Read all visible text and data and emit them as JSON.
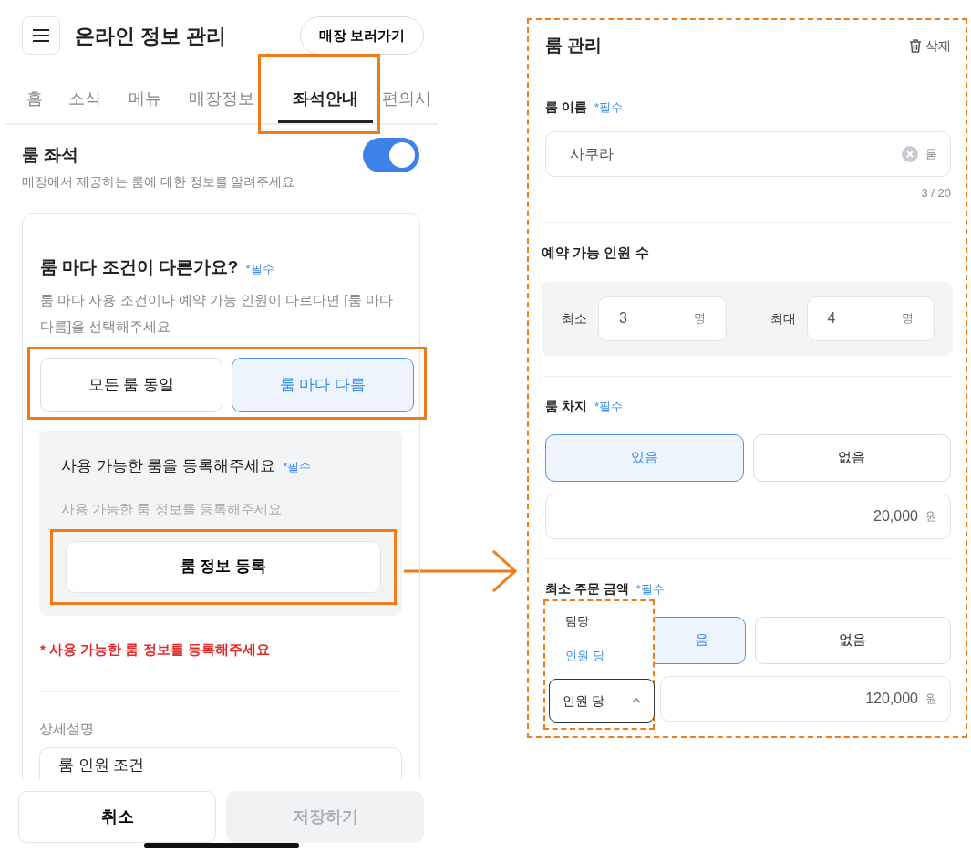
{
  "header": {
    "title": "온라인 정보 관리",
    "store_button": "매장 보러가기"
  },
  "tabs": [
    {
      "label": "홈",
      "selected": false
    },
    {
      "label": "소식",
      "selected": false
    },
    {
      "label": "메뉴",
      "selected": false
    },
    {
      "label": "매장정보",
      "selected": false
    },
    {
      "label": "좌석안내",
      "selected": true
    },
    {
      "label": "편의시",
      "selected": false
    }
  ],
  "room_seating": {
    "title": "룸 좌석",
    "on": true,
    "description": "매장에서 제공하는 룸에 대한 정보를 알려주세요"
  },
  "condition": {
    "question": "룸 마다 조건이 다른가요?",
    "required": "*필수",
    "description": "룸 마다 사용 조건이나 예약 가능 인원이 다르다면 [룸 마다 다름]을 선택해주세요",
    "options": [
      {
        "label": "모든 룸 동일",
        "selected": false
      },
      {
        "label": "룸 마다 다름",
        "selected": true
      }
    ]
  },
  "rooms": {
    "title": "사용 가능한 룸을 등록해주세요",
    "required": "*필수",
    "hint": "사용 가능한 룸 정보를 등록해주세요",
    "register_button": "룸 정보 등록"
  },
  "error": "* 사용 가능한 룸 정보를 등록해주세요",
  "detail": {
    "label": "상세설명",
    "value": "룸 인원 조건"
  },
  "footer": {
    "cancel": "취소",
    "save": {
      "label": "저장하기",
      "disabled": true
    }
  },
  "room_panel": {
    "title": "룸 관리",
    "delete": "삭제",
    "name": {
      "label": "룸 이름",
      "required": "*필수",
      "value": "사쿠라",
      "suffix": "룸",
      "counter": "3 / 20"
    },
    "capacity": {
      "label": "예약 가능 인원 수",
      "min": {
        "label": "최소",
        "value": "3",
        "unit": "명"
      },
      "max": {
        "label": "최대",
        "value": "4",
        "unit": "명"
      }
    },
    "room_charge": {
      "label": "룸 차지",
      "required": "*필수",
      "options": [
        {
          "label": "있음",
          "selected": true
        },
        {
          "label": "없음",
          "selected": false
        }
      ],
      "amount": "20,000",
      "unit": "원"
    },
    "min_order": {
      "label": "최소 주문 금액",
      "required": "*필수",
      "options": [
        {
          "label": "음",
          "selected": true
        },
        {
          "label": "없음",
          "selected": false
        }
      ],
      "basis": {
        "value": "인원 당",
        "expanded": true,
        "menu": [
          {
            "label": "팀당",
            "selected": false
          },
          {
            "label": "인원 당",
            "selected": true
          }
        ]
      },
      "amount": "120,000",
      "unit": "원"
    }
  }
}
